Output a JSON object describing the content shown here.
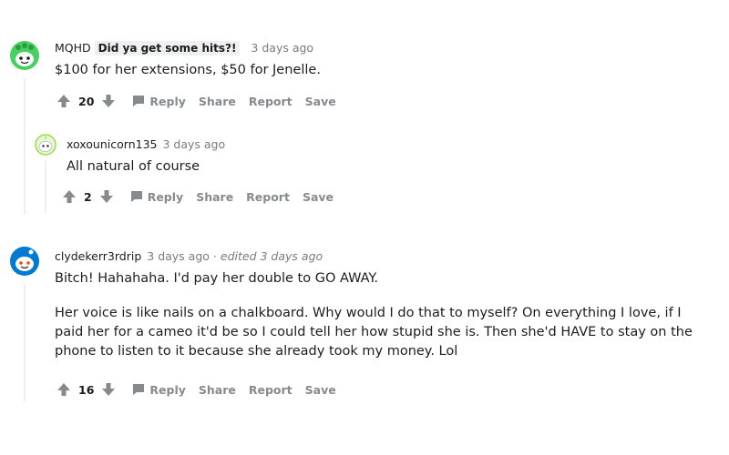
{
  "comments": [
    {
      "username": "MQHD",
      "flair": "Did ya get some hits?!",
      "time": "3 days ago",
      "edited": "",
      "paragraphs": [
        "$100 for her extensions, $50 for Jenelle."
      ],
      "score": "20",
      "avatar_color": "#46d160"
    },
    {
      "username": "xoxounicorn135",
      "flair": "",
      "time": "3 days ago",
      "edited": "",
      "paragraphs": [
        "All natural of course"
      ],
      "score": "2",
      "avatar_color": "#94e044"
    },
    {
      "username": "clydekerr3rdrip",
      "flair": "",
      "time": "3 days ago",
      "edited": "edited 3 days ago",
      "paragraphs": [
        "Bitch! Hahahaha. I'd pay her double to GO AWAY.",
        "Her voice is like nails on a chalkboard. Why would I do that to myself? On everything I love, if I paid her for a cameo it'd be so I could tell her how stupid she is. Then she'd HAVE to stay on the phone to listen to it because she already took my money. Lol"
      ],
      "score": "16",
      "avatar_color": "#0079d3"
    }
  ],
  "actions": {
    "reply": "Reply",
    "share": "Share",
    "report": "Report",
    "save": "Save"
  },
  "icons": {
    "upvote": "upvote-arrow-icon",
    "downvote": "downvote-arrow-icon",
    "reply": "reply-bubble-icon",
    "avatar": "snoo-avatar-icon"
  }
}
